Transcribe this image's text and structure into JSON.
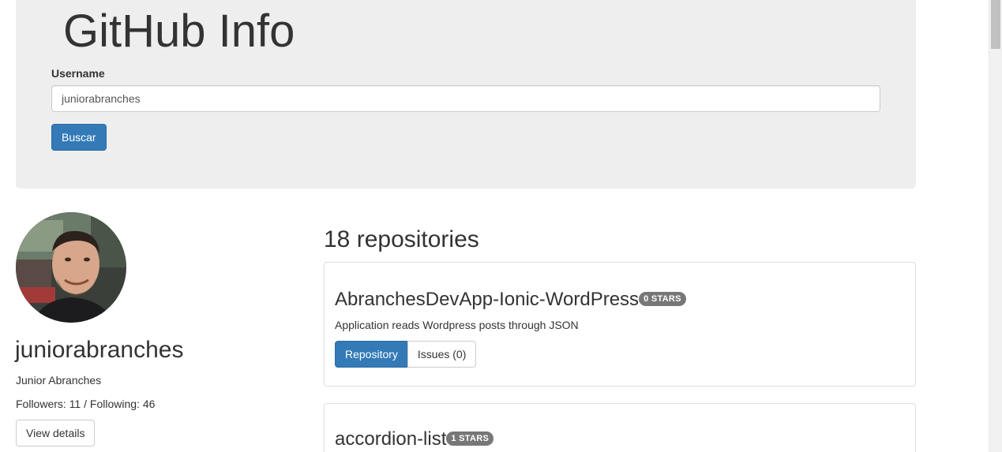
{
  "header": {
    "title": "GitHub Info",
    "username_label": "Username",
    "username_value": "juniorabranches",
    "search_button": "Buscar"
  },
  "profile": {
    "login": "juniorabranches",
    "name": "Junior Abranches",
    "followers_label": "Followers:",
    "followers": "11",
    "separator": "/",
    "following_label": "Following:",
    "following": "46",
    "details_button": "View details"
  },
  "repos": {
    "count_text": "18 repositories",
    "items": [
      {
        "name": "AbranchesDevApp-Ionic-WordPress",
        "stars_badge": "0 STARS",
        "description": "Application reads Wordpress posts through JSON",
        "repo_button": "Repository",
        "issues_button": "Issues (0)"
      },
      {
        "name": "accordion-list",
        "stars_badge": "1 STARS"
      }
    ]
  },
  "colors": {
    "primary": "#337ab7",
    "jumbotron": "#eeeeee",
    "badge": "#777777"
  }
}
